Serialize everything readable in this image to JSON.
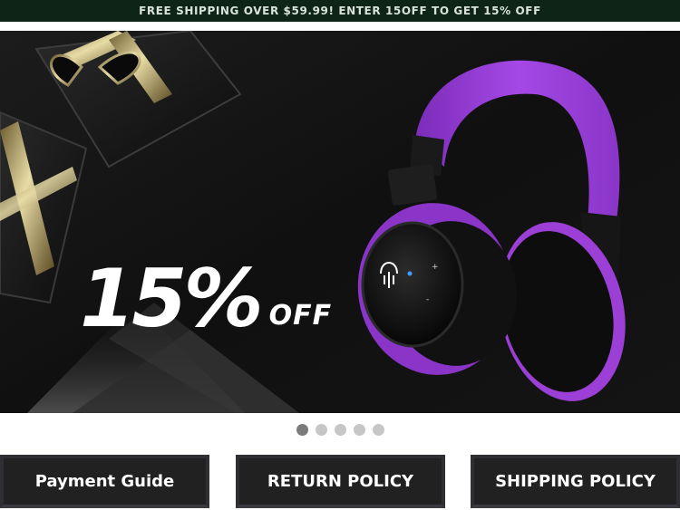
{
  "promo_bar": {
    "text": "FREE SHIPPING OVER $59.99! ENTER 15OFF TO GET 15% OFF"
  },
  "hero": {
    "headline_big": "15%",
    "headline_small": "OFF",
    "product_color": "#9b3fd6",
    "background_color": "#121212",
    "carousel": {
      "slide_count": 5,
      "active_index": 0
    }
  },
  "buttons": {
    "payment": "Payment Guide",
    "return": "RETURN POLICY",
    "shipping": "SHIPPING POLICY"
  }
}
